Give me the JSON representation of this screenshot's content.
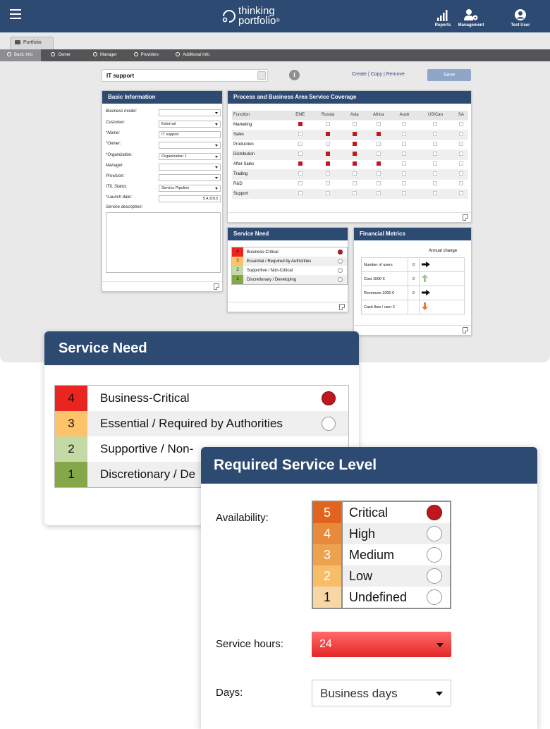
{
  "header": {
    "logo_top": "thinking",
    "logo_bottom": "portfolio",
    "logo_mark": "®",
    "actions": [
      {
        "label": "Reports",
        "icon": "bar-chart-icon"
      },
      {
        "label": "Management",
        "icon": "users-gear-icon"
      },
      {
        "label": "Test User",
        "icon": "user-avatar-icon"
      }
    ]
  },
  "tabs": {
    "portfolio": "Portfolio"
  },
  "subnav": [
    "Basic Info",
    "Owner",
    "Manager",
    "Providers",
    "Additional Info"
  ],
  "toolbar": {
    "selected_service": "IT support",
    "create": "Create",
    "copy": "Copy",
    "remove": "Remove",
    "save": "Save"
  },
  "basic_info": {
    "title": "Basic Information",
    "fields": [
      {
        "label": "Business model:",
        "value": ""
      },
      {
        "label": "Customer:",
        "value": "External"
      },
      {
        "label": "*Name:",
        "value": "IT support"
      },
      {
        "label": "*Owner:",
        "value": ""
      },
      {
        "label": "*Organization:",
        "value": "Organization 1"
      },
      {
        "label": "Manager:",
        "value": ""
      },
      {
        "label": "Provision:",
        "value": ""
      },
      {
        "label": "ITIL Status:",
        "value": "Service Pipeline"
      },
      {
        "label": "*Launch date:",
        "value": "5.4.2013"
      }
    ],
    "description_label": "Service description:"
  },
  "coverage": {
    "title": "Process and Business Area Service Coverage",
    "columns": [
      "Function",
      "EME",
      "Russia",
      "Asia",
      "Africa",
      "Austr",
      "US/Can",
      "SA"
    ],
    "rows": [
      {
        "name": "Marketing",
        "cells": [
          1,
          0,
          0,
          0,
          0,
          0,
          0
        ]
      },
      {
        "name": "Sales",
        "cells": [
          0,
          1,
          1,
          1,
          0,
          0,
          0
        ]
      },
      {
        "name": "Production",
        "cells": [
          0,
          0,
          1,
          0,
          0,
          0,
          0
        ]
      },
      {
        "name": "Distribution",
        "cells": [
          0,
          1,
          1,
          0,
          0,
          0,
          0
        ]
      },
      {
        "name": "After Sales",
        "cells": [
          1,
          1,
          1,
          1,
          0,
          0,
          0
        ]
      },
      {
        "name": "Trading",
        "cells": [
          0,
          0,
          0,
          0,
          0,
          0,
          0
        ]
      },
      {
        "name": "R&D",
        "cells": [
          0,
          0,
          0,
          0,
          0,
          0,
          0
        ]
      },
      {
        "name": "Support",
        "cells": [
          0,
          0,
          0,
          0,
          0,
          0,
          0
        ]
      }
    ]
  },
  "service_need": {
    "title": "Service Need",
    "levels": [
      {
        "num": "4",
        "label": "Business-Critical",
        "color": "#e8261f",
        "selected": true
      },
      {
        "num": "3",
        "label": "Essential / Required by Authorities",
        "color": "#fdc36a",
        "selected": false
      },
      {
        "num": "2",
        "label": "Supportive / Non-Critical",
        "color": "#c5d9a4",
        "selected": false
      },
      {
        "num": "1",
        "label": "Discretionary / Developing",
        "color": "#84a849",
        "selected": false
      }
    ]
  },
  "financial": {
    "title": "Financial Metrics",
    "annual_change": "Annual change",
    "rows": [
      {
        "label": "Number of users",
        "value": "0",
        "arrow": "right-arrow-icon"
      },
      {
        "label": "Cost 1000 €",
        "value": "0",
        "arrow": "up-arrow-icon"
      },
      {
        "label": "Revenues 1000 €",
        "value": "0",
        "arrow": "right-arrow-icon"
      },
      {
        "label": "Cash flow / user €",
        "value": "",
        "arrow": "down-arrow-icon"
      }
    ]
  },
  "service_need_zoom": {
    "title": "Service Need",
    "levels": [
      {
        "num": "4",
        "label": "Business-Critical",
        "color": "#e8261f",
        "selected": true
      },
      {
        "num": "3",
        "label": "Essential / Required by Authorities",
        "color": "#fdc36a",
        "selected": false
      },
      {
        "num": "2",
        "label": "Supportive / Non-",
        "color": "#c5d9a4",
        "selected": false
      },
      {
        "num": "1",
        "label": "Discretionary / De",
        "color": "#84a849",
        "selected": false
      }
    ]
  },
  "required_service_level": {
    "title": "Required Service Level",
    "availability_label": "Availability:",
    "availability": [
      {
        "num": "5",
        "label": "Critical",
        "color": "#e0641d",
        "selected": true
      },
      {
        "num": "4",
        "label": "High",
        "color": "#e98a3b",
        "selected": false
      },
      {
        "num": "3",
        "label": "Medium",
        "color": "#efa24e",
        "selected": false
      },
      {
        "num": "2",
        "label": "Low",
        "color": "#f6be69",
        "selected": false
      },
      {
        "num": "1",
        "label": "Undefined",
        "color": "#f7d7a6",
        "selected": false
      }
    ],
    "service_hours_label": "Service hours:",
    "service_hours": "24",
    "days_label": "Days:",
    "days": "Business days"
  },
  "colors": {
    "header": "#2d4a72",
    "checked": "#c8151b"
  }
}
